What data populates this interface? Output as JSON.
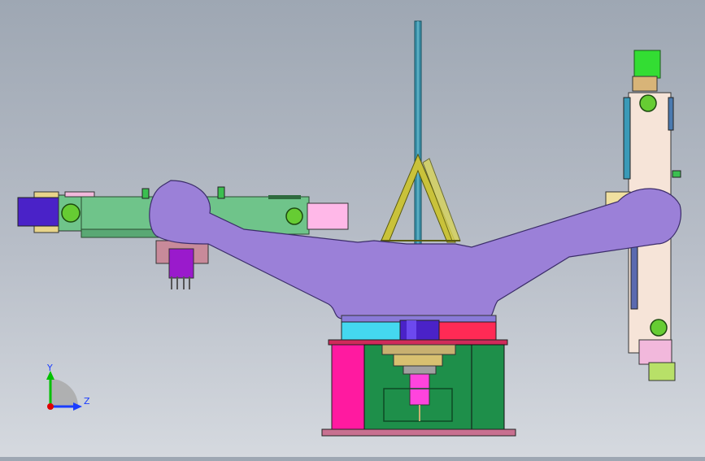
{
  "viewport": {
    "background_top": "#9ea7b3",
    "background_bottom": "#d5d9df"
  },
  "triad": {
    "y_label": "Y",
    "z_label": "Z",
    "y_color": "#00c000",
    "z_color": "#1a3cff",
    "x_color": "#e00000"
  },
  "model": {
    "arm_color": "#9b80d8",
    "base_magenta": "#ff1aa0",
    "base_green": "#1e8f4a",
    "left_link_color": "#6fc48a",
    "right_link_color": "#f6e4d8",
    "joint_circle_color": "#66cc33"
  }
}
